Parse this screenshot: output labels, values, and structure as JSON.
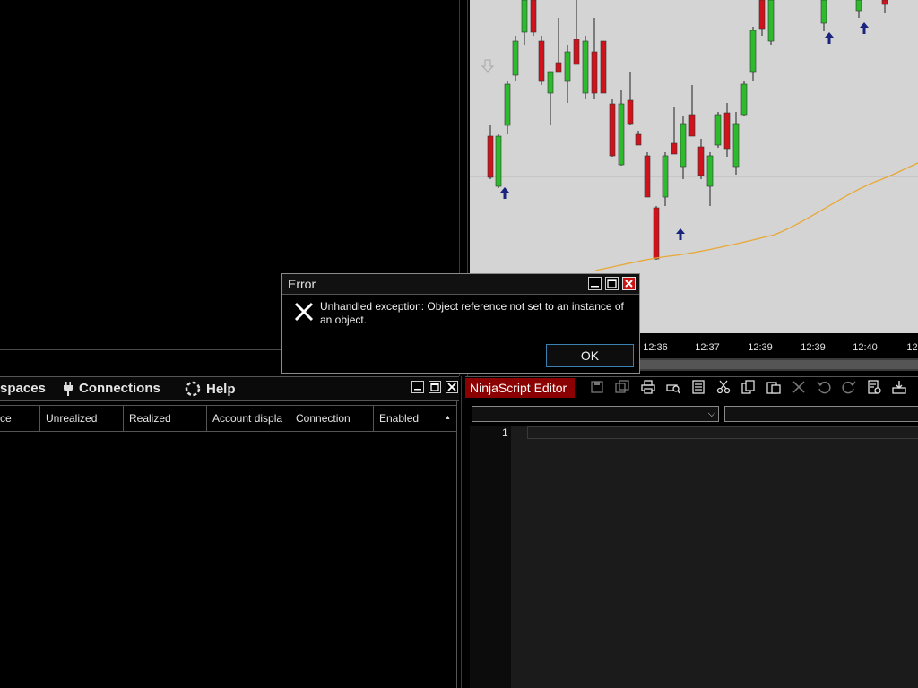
{
  "chart": {
    "time_labels": [
      "12:36",
      "12:37",
      "12:39",
      "12:39",
      "12:40",
      "12:"
    ],
    "colors": {
      "background": "#d4d4d4",
      "up": "#2dbb2d",
      "down": "#d0121b",
      "signal": "#1a237e",
      "ma": "#e8a838"
    }
  },
  "error_dialog": {
    "title": "Error",
    "message": "Unhandled exception: Object reference not set to an instance of an object.",
    "ok_label": "OK"
  },
  "accounts_panel": {
    "menu": {
      "workspaces": "spaces",
      "connections": "Connections",
      "help": "Help"
    },
    "columns": [
      "ce",
      "Unrealized",
      "Realized",
      "Account displa",
      "Connection",
      "Enabled"
    ],
    "sort_indicator": "▲"
  },
  "editor": {
    "title": "NinjaScript Editor",
    "line_number": "1",
    "toolbar_icons": [
      "save-icon",
      "save-all-icon",
      "print-icon",
      "print-preview-icon",
      "page-setup-icon",
      "cut-icon",
      "copy-icon",
      "paste-icon",
      "delete-icon",
      "undo-icon",
      "redo-icon",
      "compile-icon",
      "download-icon"
    ]
  }
}
